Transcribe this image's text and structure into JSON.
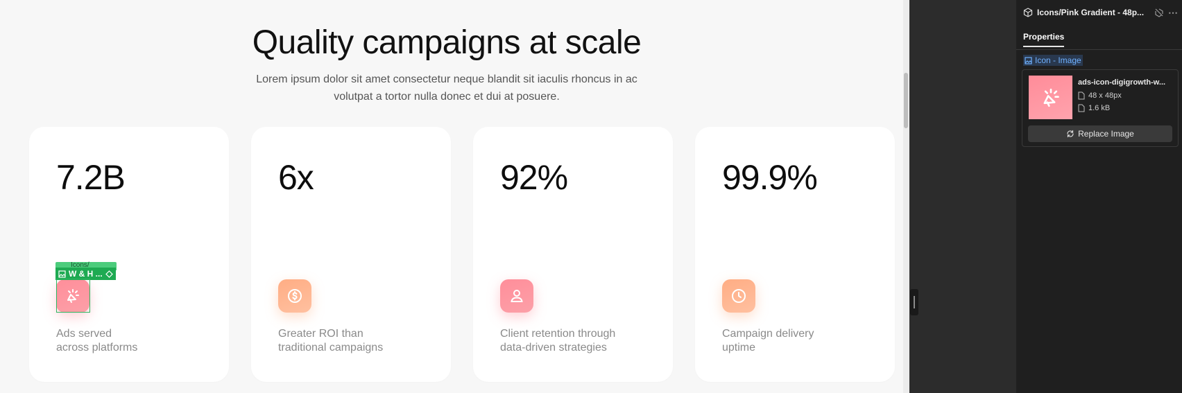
{
  "section": {
    "title": "Quality campaigns at scale",
    "subtitle": "Lorem ipsum dolor sit amet consectetur neque blandit sit iaculis rhoncus in ac volutpat a tortor nulla donec et dui at posuere."
  },
  "stats": [
    {
      "value": "7.2B",
      "label_line1": "Ads served",
      "label_line2": "across platforms",
      "icon": "megaphone-icon",
      "color": "#ff8e9a"
    },
    {
      "value": "6x",
      "label_line1": "Greater ROI than",
      "label_line2": "traditional campaigns",
      "icon": "dollar-icon",
      "color": "#ffad84"
    },
    {
      "value": "92%",
      "label_line1": "Client retention through",
      "label_line2": "data-driven strategies",
      "icon": "user-icon",
      "color": "#ff8e9a"
    },
    {
      "value": "99.9%",
      "label_line1": "Campaign delivery",
      "label_line2": "uptime",
      "icon": "clock-icon",
      "color": "#ffad84"
    }
  ],
  "selection": {
    "tag_top": "Icons/",
    "tag_label": "W & H ..."
  },
  "panel": {
    "title": "Icons/Pink Gradient - 48p...",
    "tab": "Properties",
    "section_label": "Icon - Image",
    "file_name": "ads-icon-digigrowth-w...",
    "dimensions": "48 x 48px",
    "size": "1.6 kB",
    "replace_label": "Replace Image"
  }
}
